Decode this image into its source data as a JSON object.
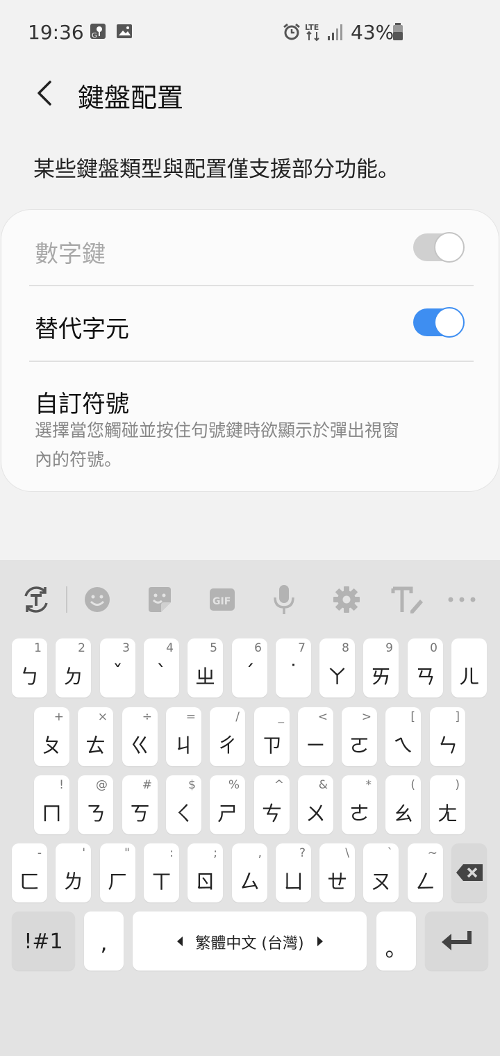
{
  "status_bar": {
    "time": "19:36",
    "battery": "43%",
    "network": "LTE"
  },
  "header": {
    "title": "鍵盤配置"
  },
  "description": "某些鍵盤類型與配置僅支援部分功能。",
  "settings": {
    "numeric_keys": {
      "label": "數字鍵",
      "on": false,
      "disabled": true
    },
    "alt_chars": {
      "label": "替代字元",
      "on": true
    },
    "custom_symbols": {
      "label": "自訂符號",
      "sub_line1": "選擇當您觸碰並按住句號鍵時欲顯示於彈出視窗",
      "sub_line2": "內的符號。"
    }
  },
  "keyboard": {
    "rows": [
      [
        [
          "ㄅ",
          "1"
        ],
        [
          "ㄉ",
          "2"
        ],
        [
          "ˇ",
          "3"
        ],
        [
          "ˋ",
          "4"
        ],
        [
          "ㄓ",
          "5"
        ],
        [
          "ˊ",
          "6"
        ],
        [
          "˙",
          "7"
        ],
        [
          "ㄚ",
          "8"
        ],
        [
          "ㄞ",
          "9"
        ],
        [
          "ㄢ",
          "0"
        ],
        [
          "ㄦ",
          ""
        ]
      ],
      [
        [
          "ㄆ",
          "+"
        ],
        [
          "ㄊ",
          "×"
        ],
        [
          "ㄍ",
          "÷"
        ],
        [
          "ㄐ",
          "="
        ],
        [
          "ㄔ",
          "/"
        ],
        [
          "ㄗ",
          "_"
        ],
        [
          "ㄧ",
          "<"
        ],
        [
          "ㄛ",
          ">"
        ],
        [
          "ㄟ",
          "["
        ],
        [
          "ㄣ",
          "]"
        ]
      ],
      [
        [
          "ㄇ",
          "!"
        ],
        [
          "ㄋ",
          "@"
        ],
        [
          "ㄎ",
          "#"
        ],
        [
          "ㄑ",
          "$"
        ],
        [
          "ㄕ",
          "%"
        ],
        [
          "ㄘ",
          "^"
        ],
        [
          "ㄨ",
          "&"
        ],
        [
          "ㄜ",
          "*"
        ],
        [
          "ㄠ",
          "("
        ],
        [
          "ㄤ",
          ")"
        ]
      ],
      [
        [
          "ㄈ",
          "-"
        ],
        [
          "ㄌ",
          "'"
        ],
        [
          "ㄏ",
          "\""
        ],
        [
          "ㄒ",
          ":"
        ],
        [
          "ㄖ",
          ";"
        ],
        [
          "ㄙ",
          ","
        ],
        [
          "ㄩ",
          "?"
        ],
        [
          "ㄝ",
          "\\"
        ],
        [
          "ㄡ",
          "`"
        ],
        [
          "ㄥ",
          "~"
        ]
      ]
    ],
    "symbols_key": "!#1",
    "comma_key": ",",
    "space_label": "繁體中文 (台灣)",
    "period_key": "。",
    "gif_label": "GIF",
    "colors": {
      "toggle_on": "#3e8ef1",
      "toggle_off": "#d0d0d0",
      "icon_gray": "#b3b3b3"
    }
  }
}
